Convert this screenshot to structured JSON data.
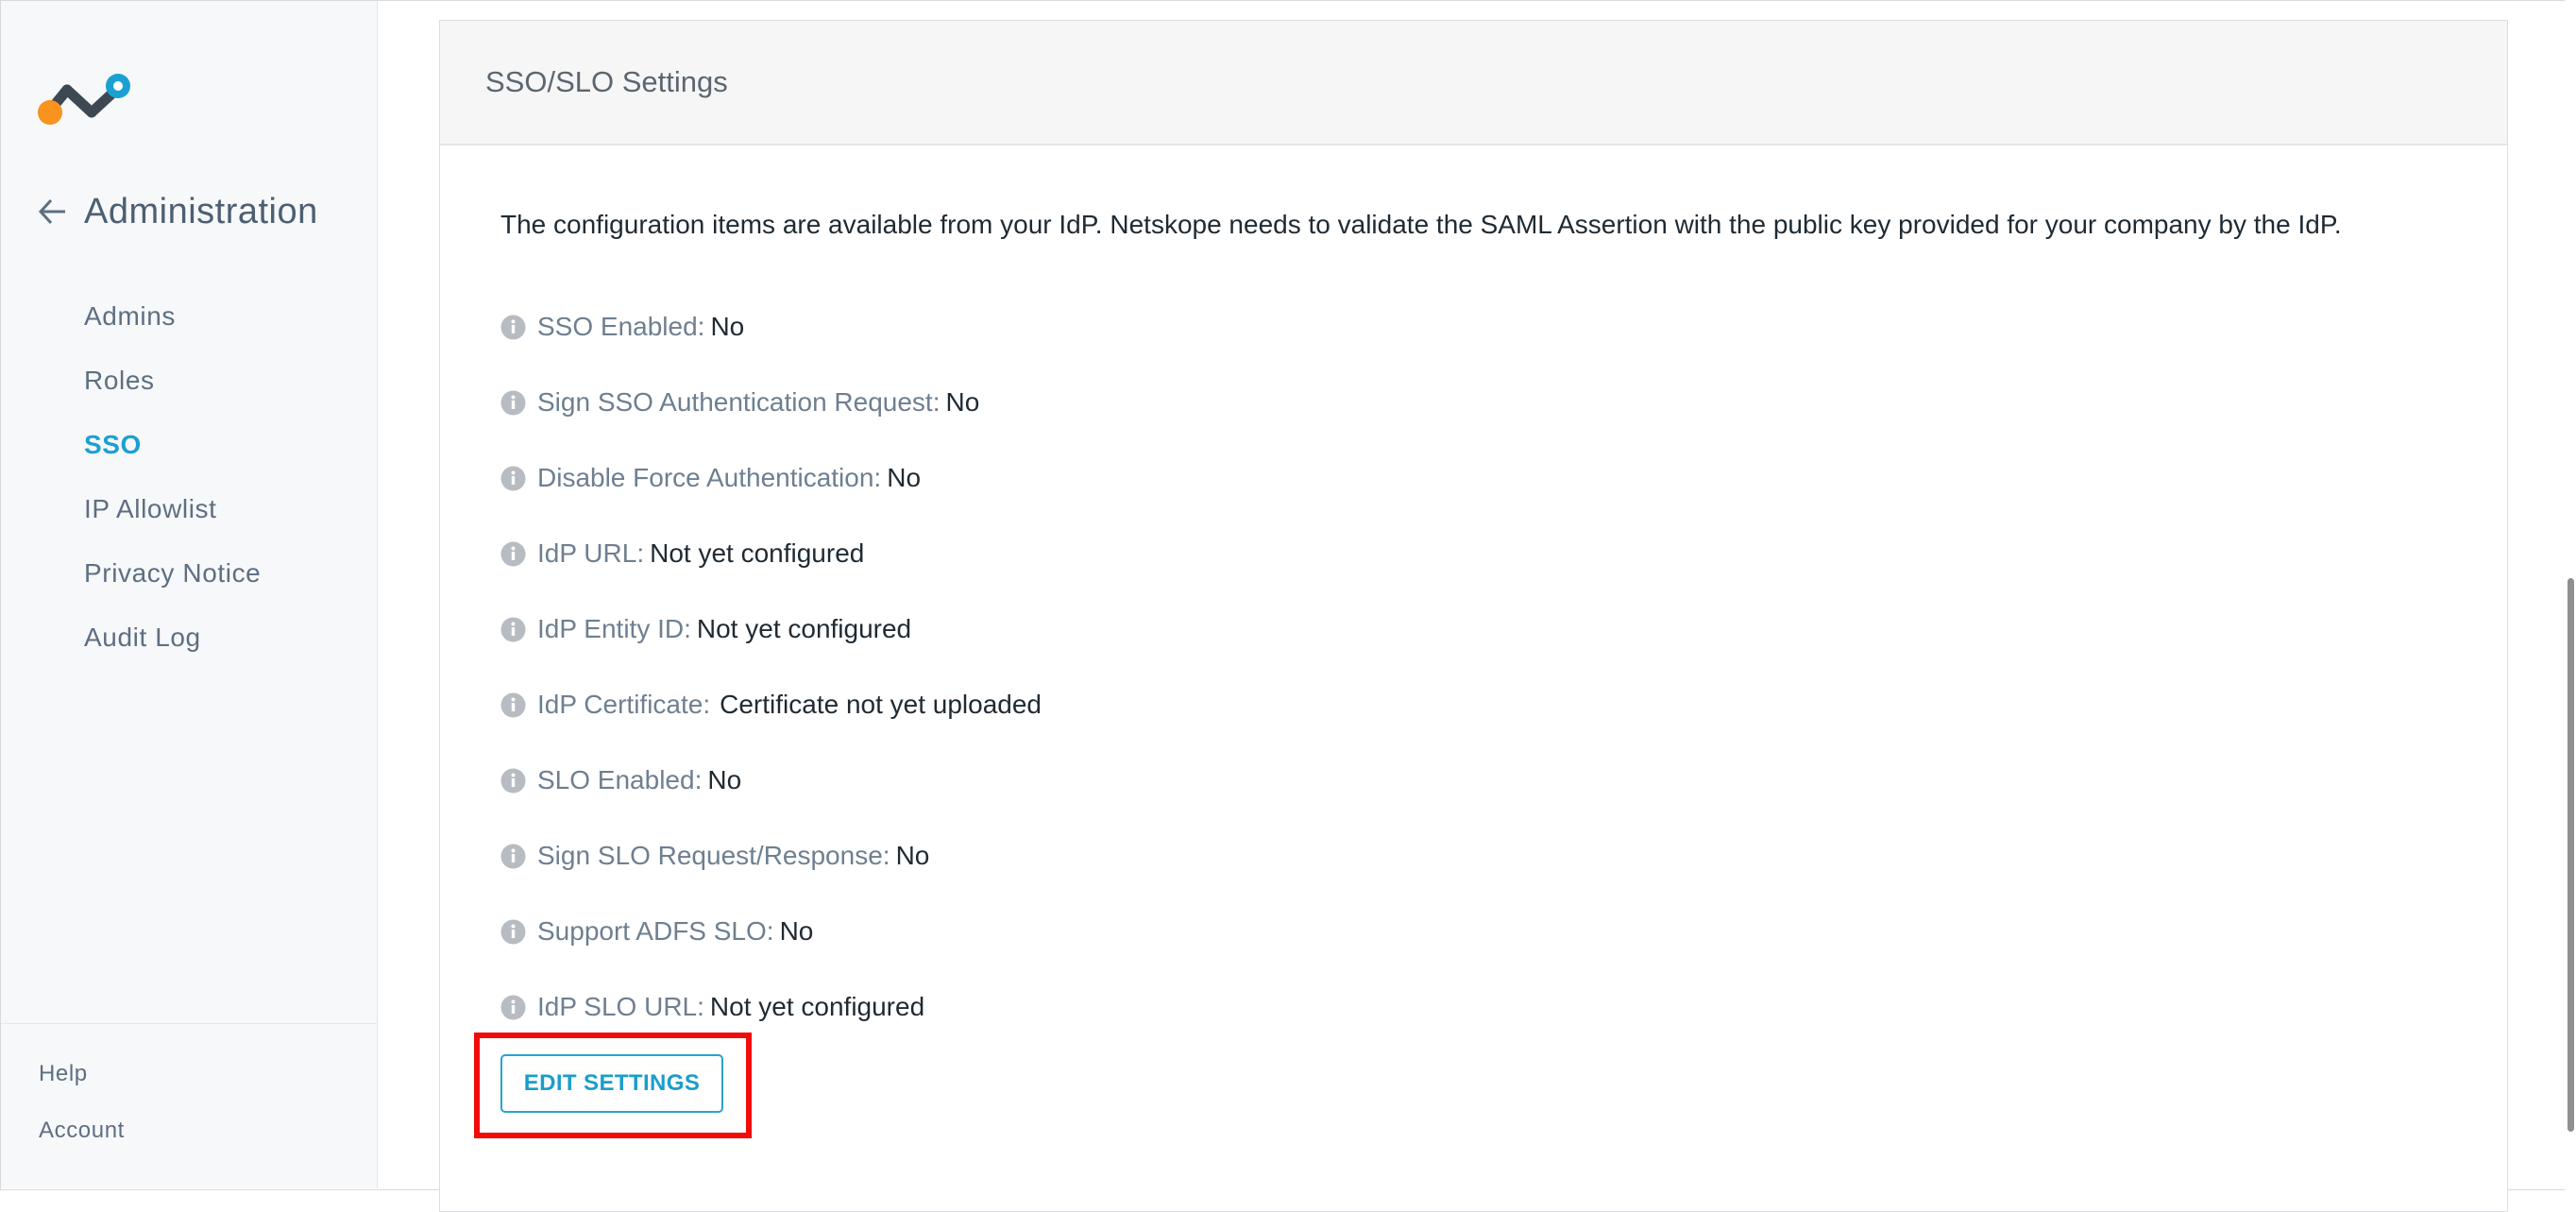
{
  "sidebar": {
    "section_title": "Administration",
    "items": [
      {
        "label": "Admins",
        "active": false
      },
      {
        "label": "Roles",
        "active": false
      },
      {
        "label": "SSO",
        "active": true
      },
      {
        "label": "IP Allowlist",
        "active": false
      },
      {
        "label": "Privacy Notice",
        "active": false
      },
      {
        "label": "Audit Log",
        "active": false
      }
    ],
    "bottom": [
      {
        "label": "Help"
      },
      {
        "label": "Account"
      }
    ]
  },
  "panel": {
    "title": "SSO/SLO Settings",
    "intro": "The configuration items are available from your IdP. Netskope needs to validate the SAML Assertion with the public key provided for your company by the IdP.",
    "fields": [
      {
        "label": "SSO Enabled:",
        "value": "No"
      },
      {
        "label": "Sign SSO Authentication Request:",
        "value": "No"
      },
      {
        "label": "Disable Force Authentication:",
        "value": "No"
      },
      {
        "label": "IdP URL:",
        "value": "Not yet configured"
      },
      {
        "label": "IdP Entity ID:",
        "value": "Not yet configured"
      },
      {
        "label": "IdP Certificate:",
        "value": "Certificate not yet uploaded"
      },
      {
        "label": "SLO Enabled:",
        "value": "No"
      },
      {
        "label": "Sign SLO Request/Response:",
        "value": "No"
      },
      {
        "label": "Support ADFS SLO:",
        "value": "No"
      },
      {
        "label": "IdP SLO URL:",
        "value": "Not yet configured"
      }
    ],
    "edit_button_label": "EDIT SETTINGS"
  },
  "colors": {
    "accent": "#1aa1d2",
    "highlight_border": "#f10c0c",
    "label_text": "#6e7f90",
    "logo_orange": "#f7931e",
    "logo_dark": "#3d4852",
    "logo_blue": "#1aa1d2"
  },
  "icons": {
    "logo": "netskope-logo",
    "back": "arrow-left-icon",
    "field_info": "info-icon"
  }
}
